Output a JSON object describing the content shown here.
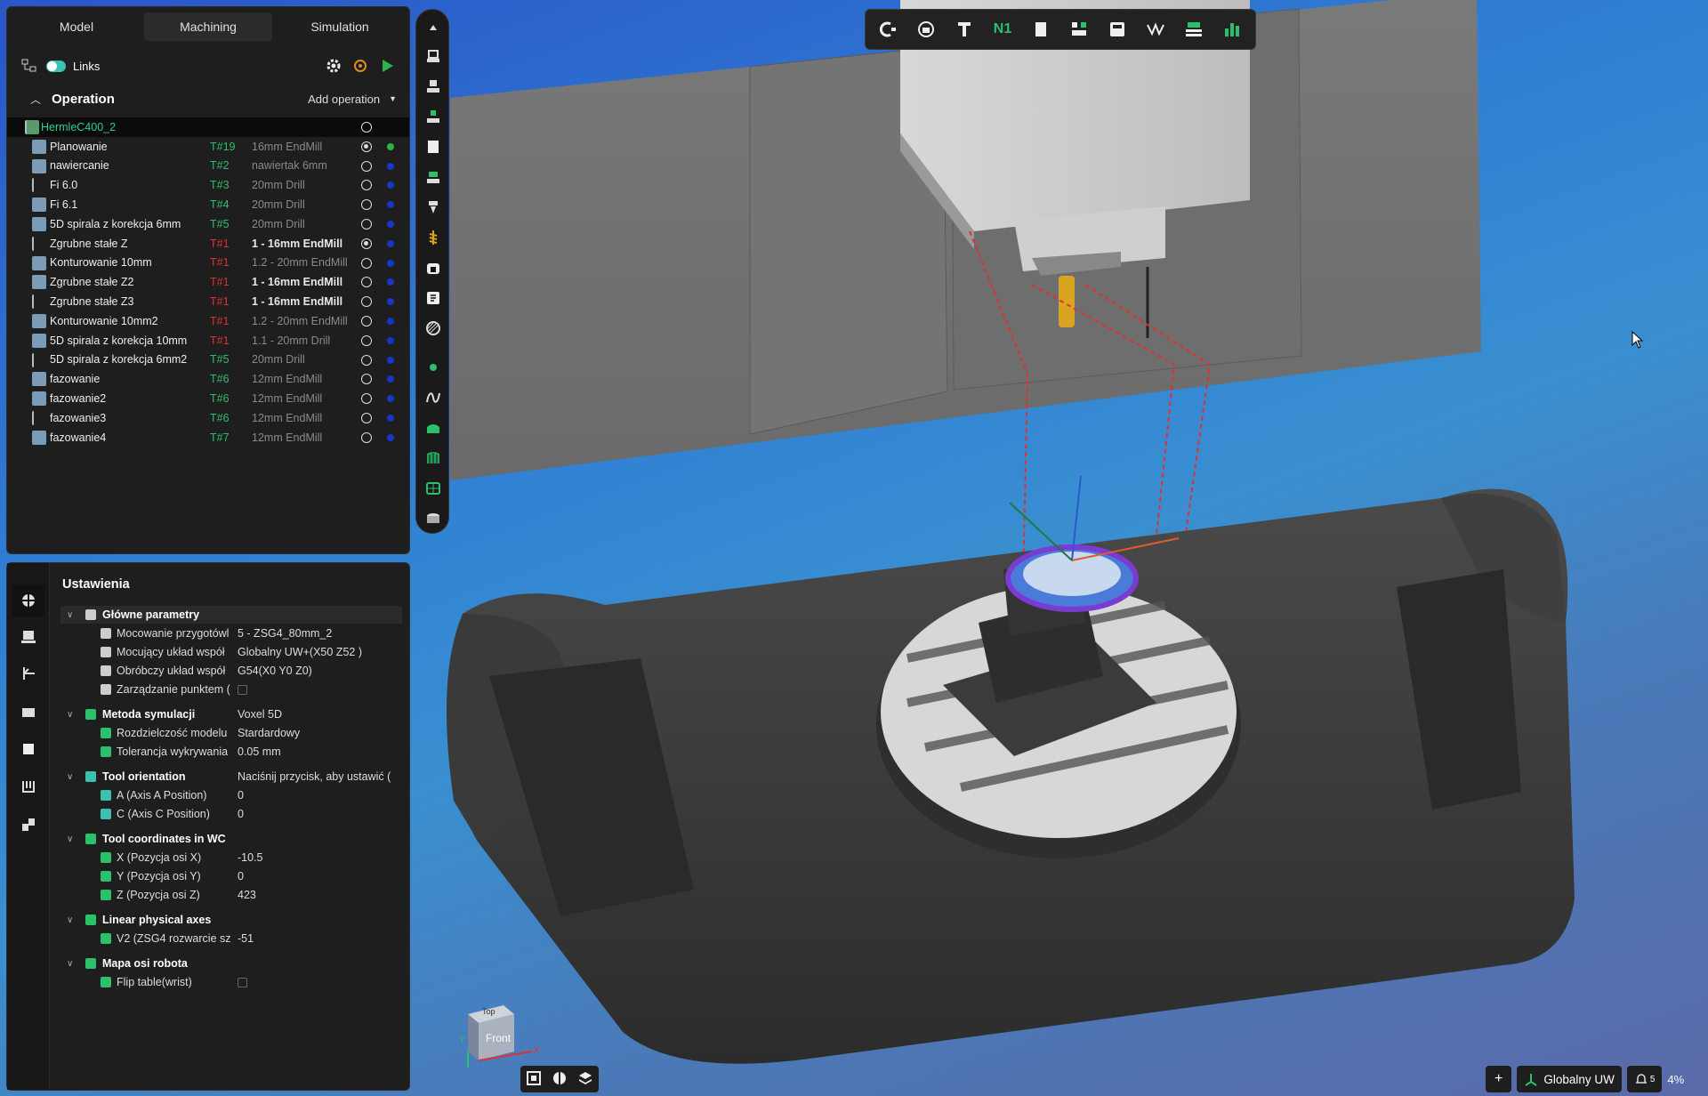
{
  "tabs": [
    "Model",
    "Machining",
    "Simulation"
  ],
  "active_tab": "Machining",
  "links_label": "Links",
  "operation_title": "Operation",
  "add_operation_label": "Add operation",
  "operations": [
    {
      "name": "HermleC400_2",
      "tool": "",
      "desc": "",
      "root": true
    },
    {
      "name": "Planowanie",
      "tool": "T#19",
      "desc": "16mm EndMill",
      "tool_color": "green",
      "selected": true,
      "status": "green"
    },
    {
      "name": "nawiercanie",
      "tool": "T#2",
      "desc": "nawiertak 6mm",
      "tool_color": "green"
    },
    {
      "name": "Fi 6.0",
      "tool": "T#3",
      "desc": "20mm Drill",
      "tool_color": "green"
    },
    {
      "name": "Fi 6.1",
      "tool": "T#4",
      "desc": "20mm Drill",
      "tool_color": "green"
    },
    {
      "name": "5D spirala z korekcja 6mm",
      "tool": "T#5",
      "desc": "20mm Drill",
      "tool_color": "green"
    },
    {
      "name": "Zgrubne stałe Z",
      "tool": "T#1",
      "desc": "1 - 16mm EndMill",
      "tool_color": "red",
      "bold": true,
      "selected": true
    },
    {
      "name": "Konturowanie 10mm",
      "tool": "T#1",
      "desc": "1.2 - 20mm EndMill",
      "tool_color": "red"
    },
    {
      "name": "Zgrubne stałe Z2",
      "tool": "T#1",
      "desc": "1 - 16mm EndMill",
      "tool_color": "red",
      "bold": true
    },
    {
      "name": "Zgrubne stałe Z3",
      "tool": "T#1",
      "desc": "1 - 16mm EndMill",
      "tool_color": "red",
      "bold": true
    },
    {
      "name": "Konturowanie 10mm2",
      "tool": "T#1",
      "desc": "1.2 - 20mm EndMill",
      "tool_color": "red"
    },
    {
      "name": "5D spirala z korekcja 10mm",
      "tool": "T#1",
      "desc": "1.1 - 20mm Drill",
      "tool_color": "red"
    },
    {
      "name": "5D spirala z korekcja 6mm2",
      "tool": "T#5",
      "desc": "20mm Drill",
      "tool_color": "green"
    },
    {
      "name": "fazowanie",
      "tool": "T#6",
      "desc": "12mm EndMill",
      "tool_color": "green"
    },
    {
      "name": "fazowanie2",
      "tool": "T#6",
      "desc": "12mm EndMill",
      "tool_color": "green"
    },
    {
      "name": "fazowanie3",
      "tool": "T#6",
      "desc": "12mm EndMill",
      "tool_color": "green"
    },
    {
      "name": "fazowanie4",
      "tool": "T#7",
      "desc": "12mm EndMill",
      "tool_color": "green"
    }
  ],
  "settings": {
    "title": "Ustawienia",
    "groups": [
      {
        "label": "Główne parametry",
        "rows": [
          {
            "label": "Mocowanie przygotówl",
            "value": "5 - ZSG4_80mm_2"
          },
          {
            "label": "Mocujący układ współ",
            "value": "Globalny UW+(X50 Z52 )"
          },
          {
            "label": "Obróbczy układ współ",
            "value": "G54(X0 Y0 Z0)"
          },
          {
            "label": "Zarządzanie punktem (",
            "value": "",
            "checkbox": true
          }
        ]
      },
      {
        "label": "Metoda symulacji",
        "value": "Voxel 5D",
        "rows": [
          {
            "label": "Rozdzielczość modelu",
            "value": "Stardardowy"
          },
          {
            "label": "Tolerancja wykrywania",
            "value": "0.05 mm"
          }
        ]
      },
      {
        "label": "Tool orientation",
        "value": "Naciśnij przycisk, aby ustawić (",
        "rows": [
          {
            "label": "A (Axis A Position)",
            "value": "0"
          },
          {
            "label": "C (Axis C Position)",
            "value": "0"
          }
        ]
      },
      {
        "label": "Tool coordinates in WC",
        "value": "",
        "rows": [
          {
            "label": "X (Pozycja osi X)",
            "value": "-10.5"
          },
          {
            "label": "Y (Pozycja osi Y)",
            "value": "0"
          },
          {
            "label": "Z (Pozycja osi Z)",
            "value": "423"
          }
        ]
      },
      {
        "label": "Linear physical axes",
        "value": "",
        "rows": [
          {
            "label": "V2 (ZSG4 rozwarcie sz",
            "value": "-51"
          }
        ]
      },
      {
        "label": "Mapa osi robota",
        "value": "",
        "rows": [
          {
            "label": "Flip table(wrist)",
            "value": "",
            "checkbox": true
          }
        ]
      }
    ]
  },
  "toolbar_top": {
    "n1_label": "N1"
  },
  "view_cube": {
    "top": "Top",
    "front": "Front",
    "x_label": "X",
    "y_label": "Y"
  },
  "status": {
    "coord_system": "Globalny UW",
    "notifications": "5",
    "zoom": "4%"
  },
  "colors": {
    "accent_green": "#2bc06a",
    "tool_red": "#e03030",
    "toggle": "#3cc0b0",
    "status_blue": "#1636c8"
  }
}
